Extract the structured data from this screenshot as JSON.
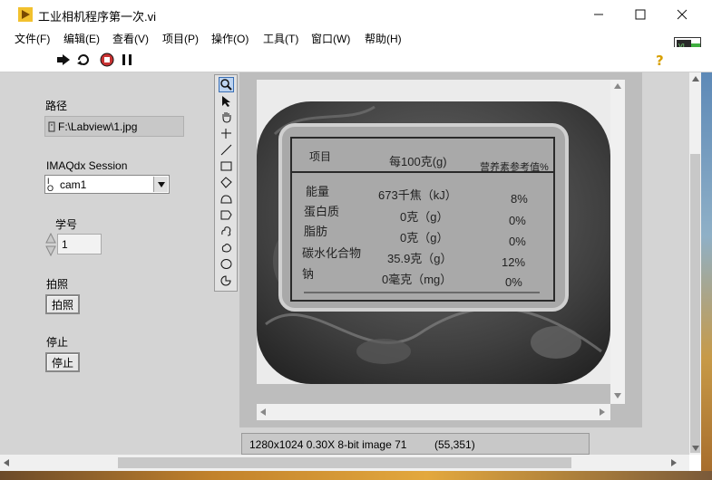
{
  "window": {
    "title": "工业相机程序第一次.vi",
    "minimize_icon": "minimize-icon",
    "maximize_icon": "maximize-icon",
    "close_icon": "close-icon"
  },
  "menu": [
    "文件(F)",
    "编辑(E)",
    "查看(V)",
    "项目(P)",
    "操作(O)",
    "工具(T)",
    "窗口(W)",
    "帮助(H)"
  ],
  "toolbar": {
    "icons": [
      "run-arrow-icon",
      "run-continuously-icon",
      "abort-icon",
      "pause-icon"
    ],
    "help_icon": "help-icon",
    "vi_icon_text": "2"
  },
  "controls": {
    "path_label": "路径",
    "path_value": "F:\\Labview\\1.jpg",
    "session_label": "IMAQdx Session",
    "session_value": "cam1",
    "id_label": "学号",
    "id_value": "1",
    "capture_label": "拍照",
    "capture_button": "拍照",
    "stop_label": "停止",
    "stop_button": "停止"
  },
  "image_display": {
    "status_info": "1280x1024 0.30X 8-bit image 71",
    "coords": "(55,351)",
    "label": {
      "header_item": "项目",
      "header_per100": "每100克(g)",
      "header_nrv": "营养素参考值%",
      "rows": [
        {
          "name": "能量",
          "amount": "673千焦（kJ）",
          "nrv": "8%"
        },
        {
          "name": "蛋白质",
          "amount": "0克（g）",
          "nrv": "0%"
        },
        {
          "name": "脂肪",
          "amount": "0克（g）",
          "nrv": "0%"
        },
        {
          "name": "碳水化合物",
          "amount": "35.9克（g）",
          "nrv": "12%"
        },
        {
          "name": "钠",
          "amount": "0毫克（mg）",
          "nrv": "0%"
        }
      ]
    }
  },
  "palette_tools": [
    "zoom-icon",
    "pointer-icon",
    "pan-hand-icon",
    "point-icon",
    "line-icon",
    "rectangle-icon",
    "rotated-rectangle-icon",
    "annulus-icon",
    "polygon-icon",
    "freehand-icon",
    "closed-freehand-icon",
    "oval-icon",
    "broken-line-icon"
  ]
}
